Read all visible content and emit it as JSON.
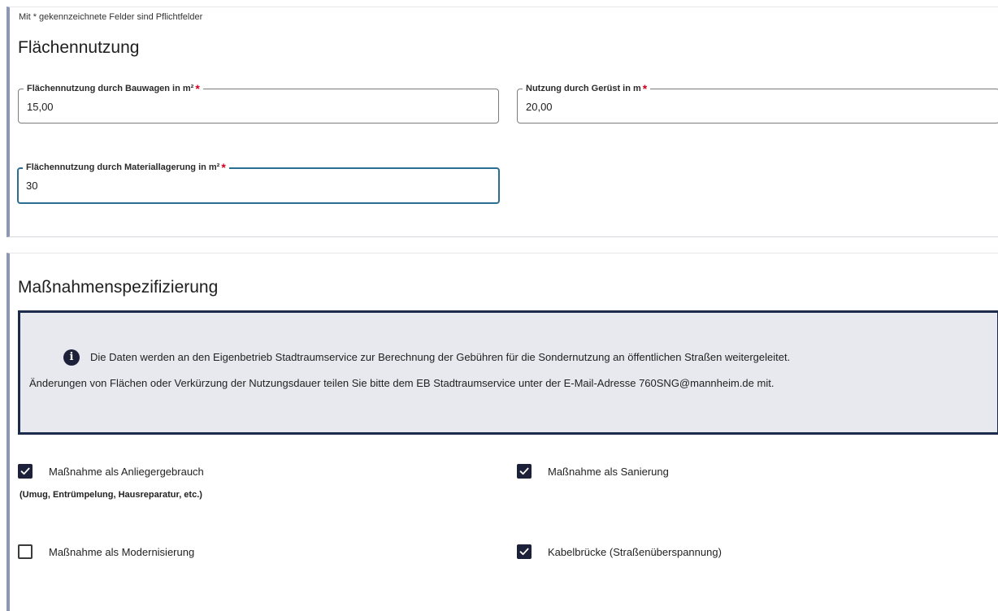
{
  "form": {
    "required_note": "Mit * gekennzeichnete Felder sind Pflichtfelder"
  },
  "flaechennutzung": {
    "title": "Flächennutzung",
    "fields": [
      {
        "label": "Flächennutzung durch Bauwagen in m²",
        "required_mark": "*",
        "value": "15,00"
      },
      {
        "label": "Nutzung durch Gerüst in m",
        "required_mark": "*",
        "value": "20,00"
      },
      {
        "label": "Flächennutzung durch Materiallagerung in m²",
        "required_mark": "*",
        "value": "30"
      }
    ]
  },
  "massnahmen": {
    "title": "Maßnahmenspezifizierung",
    "info": {
      "icon": "info-icon",
      "line1": "Die Daten werden an den Eigenbetrieb Stadtraumservice zur Berechnung der Gebühren für die Sondernutzung an öffentlichen Straßen weitergeleitet.",
      "line2": "Änderungen von Flächen oder Verkürzung der Nutzungsdauer teilen Sie bitte dem EB Stadtraumservice unter der E-Mail-Adresse 760SNG@mannheim.de mit."
    },
    "checkboxes": [
      {
        "label": "Maßnahme als Anliegergebrauch",
        "sublabel": "(Umug, Entrümpelung, Hausreparatur, etc.)",
        "checked": true
      },
      {
        "label": "Maßnahme als Sanierung",
        "checked": true
      },
      {
        "label": "Maßnahme als Modernisierung",
        "checked": false
      },
      {
        "label": "Kabelbrücke (Straßenüberspannung)",
        "checked": true
      }
    ]
  },
  "colors": {
    "accent_dark": "#1c2038",
    "focus_border": "#2a6e92",
    "required_star": "#d1001f",
    "info_background": "#e8e9ef",
    "info_border": "#1c2a4c"
  }
}
